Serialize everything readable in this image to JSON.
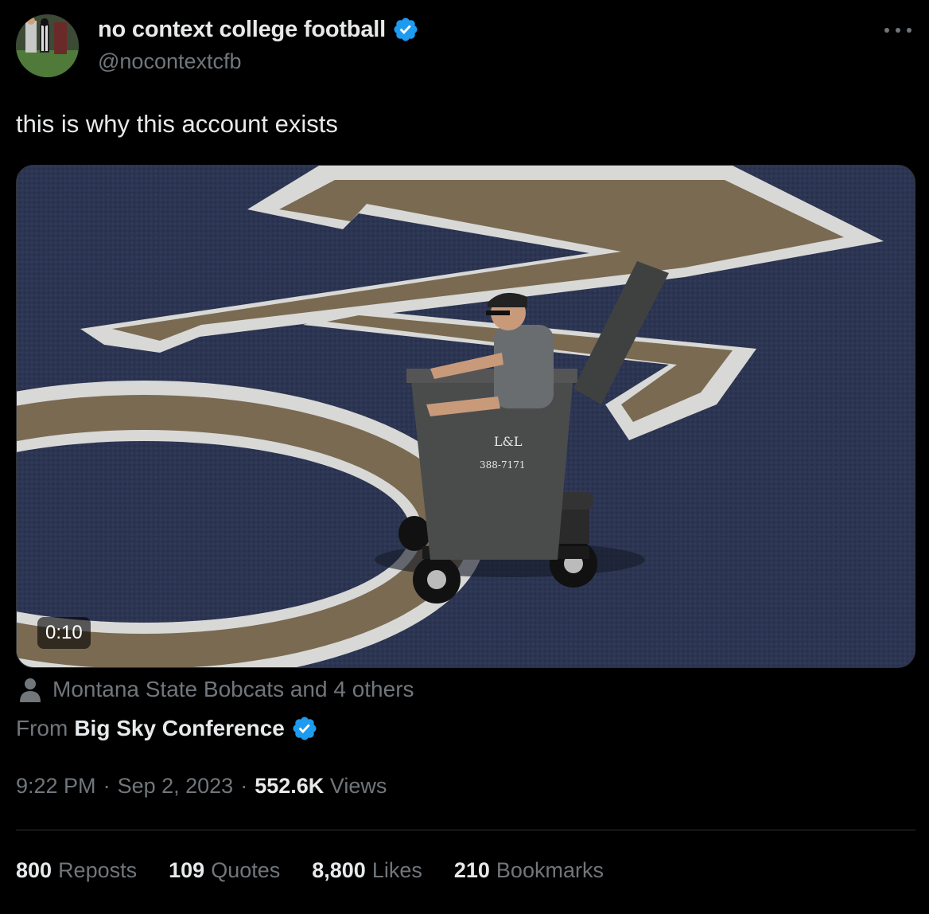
{
  "author": {
    "display_name": "no context college football",
    "handle": "@nocontextcfb",
    "verified_badge_color": "#1d9bf0"
  },
  "tweet": {
    "text": "this is why this account exists"
  },
  "media": {
    "duration": "0:10",
    "bin_label_logo": "L&L",
    "bin_label_phone": "388-7171",
    "field_color": "#2b3450",
    "numeral_fill_color": "#7a6a52",
    "numeral_outline_color": "#d8d8d6"
  },
  "tagged": {
    "text": "Montana State Bobcats and 4 others"
  },
  "source": {
    "label": "From",
    "name": "Big Sky Conference"
  },
  "meta": {
    "time": "9:22 PM",
    "sep1": "·",
    "date": "Sep 2, 2023",
    "sep2": "·",
    "views_count": "552.6K",
    "views_label": "Views"
  },
  "stats": [
    {
      "num": "800",
      "label": "Reposts"
    },
    {
      "num": "109",
      "label": "Quotes"
    },
    {
      "num": "8,800",
      "label": "Likes"
    },
    {
      "num": "210",
      "label": "Bookmarks"
    }
  ]
}
